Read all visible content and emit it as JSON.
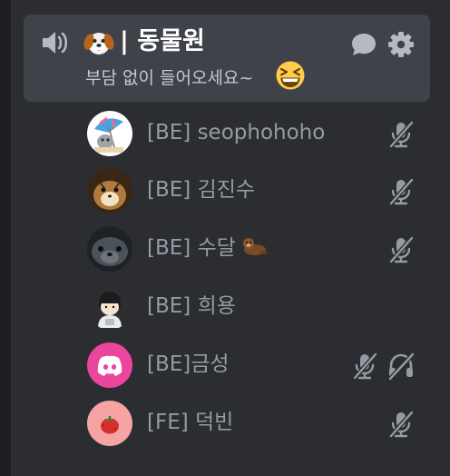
{
  "channel": {
    "name": "| 동물원",
    "status": "부담 없이 들어오세요~",
    "channel_emoji": "dog-face",
    "status_emoji": "laughing-face"
  },
  "members": [
    {
      "name": "[BE] seophohoho",
      "muted": true,
      "deafened": false,
      "avatar": "cartoon-avatar"
    },
    {
      "name": "[BE] 김진수",
      "muted": true,
      "deafened": false,
      "avatar": "chipmunk-avatar"
    },
    {
      "name": "[BE] 수달",
      "muted": true,
      "deafened": false,
      "avatar": "seal-avatar",
      "emoji": "otter"
    },
    {
      "name": "[BE] 희용",
      "muted": false,
      "deafened": false,
      "avatar": "boy-avatar"
    },
    {
      "name": "[BE]금성",
      "muted": true,
      "deafened": true,
      "avatar": "discord-default-avatar"
    },
    {
      "name": "[FE] 덕빈",
      "muted": true,
      "deafened": false,
      "avatar": "tomato-avatar"
    }
  ],
  "colors": {
    "background": "#2b2d31",
    "channel_highlight": "#404249",
    "member_name": "#949ba4",
    "icon": "#b5bac1",
    "discord_avatar": "#eb459e"
  }
}
